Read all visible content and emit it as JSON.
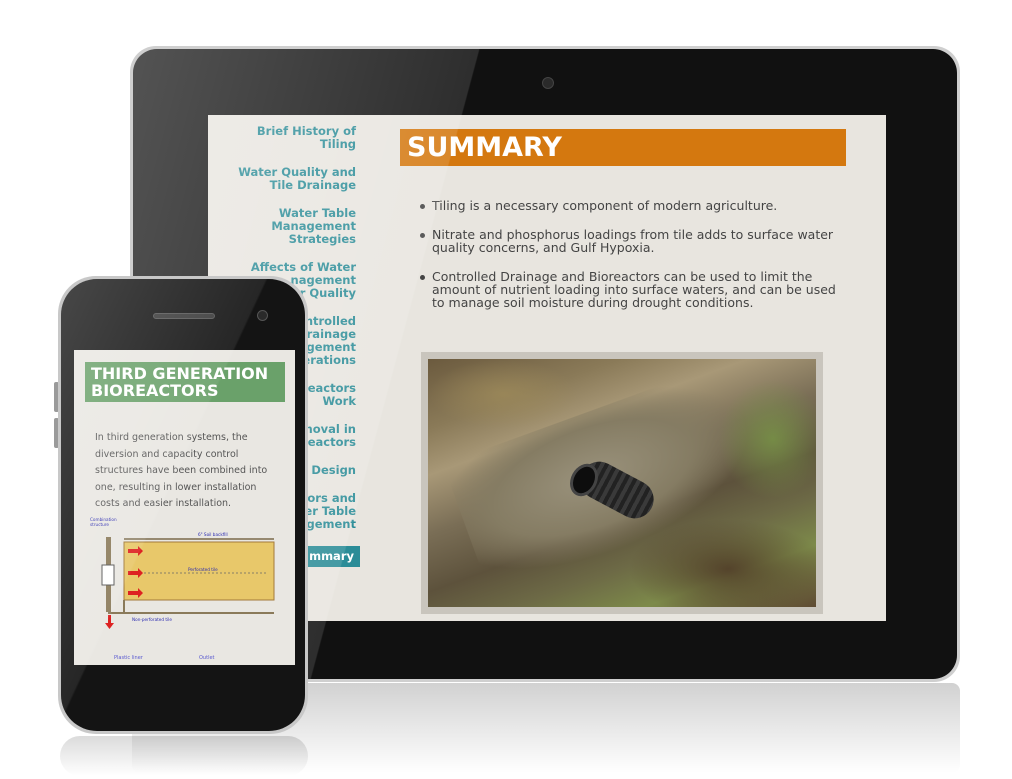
{
  "tablet": {
    "nav": [
      {
        "label_l1": "Brief History of",
        "label_l2": "Tiling"
      },
      {
        "label_l1": "Water Quality and",
        "label_l2": "Tile Drainage"
      },
      {
        "label_l1": "Water Table",
        "label_l2": "Management",
        "label_l3": "Strategies"
      },
      {
        "label_l1": "Affects of Water",
        "label_l2": "nagement",
        "label_l3": "er Quality"
      },
      {
        "label_l1": "ontrolled",
        "label_l2": "Drainage",
        "label_l3": "agement",
        "label_l4": "iderations"
      },
      {
        "label_l1": "oreactors",
        "label_l2": "Work"
      },
      {
        "label_l1": "moval in",
        "label_l2": "oreactors"
      },
      {
        "label_l1": "or Design"
      },
      {
        "label_l1": "ctors and",
        "label_l2": "ter Table",
        "label_l3": "agement"
      },
      {
        "label_l1": "mmary",
        "active": true
      }
    ],
    "title": "SUMMARY",
    "bullets": [
      "Tiling is a necessary component of modern agriculture.",
      "Nitrate and phosphorus loadings from tile adds to surface water quality concerns, and Gulf Hypoxia.",
      "Controlled Drainage and Bioreactors can be used to limit the amount of nutrient loading into surface waters, and can be used to manage soil moisture during drought conditions."
    ]
  },
  "phone": {
    "title_l1": "THIRD GENERATION",
    "title_l2": "BIOREACTORS",
    "body": "In third generation systems, the diversion and capacity control structures have been combined into one, resulting in lower installation costs and easier installation.",
    "diagram": {
      "label_structure_1": "Combination",
      "label_structure_2": "structure",
      "label_backfill": "6\" Soil backfill",
      "label_perforated": "Perforated tile",
      "label_nonperforated": "Non-perforated tile"
    },
    "faint_label_1": "Plastic liner",
    "faint_label_2": "Outlet"
  },
  "colors": {
    "teal": "#2b8c97",
    "orange": "#d4780f",
    "green": "#6aa16a",
    "screen_bg": "#e8e5df"
  }
}
